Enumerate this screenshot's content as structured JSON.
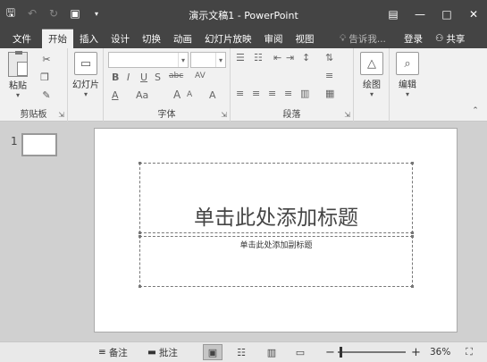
{
  "window": {
    "title": "演示文稿1 - PowerPoint"
  },
  "qat": {
    "save_icon": "save-icon",
    "undo_icon": "undo-icon",
    "redo_icon": "redo-icon",
    "present_icon": "present-from-start-icon",
    "customize_icon": "customize-qat-icon"
  },
  "tabs": [
    "文件",
    "开始",
    "插入",
    "设计",
    "切换",
    "动画",
    "幻灯片放映",
    "审阅",
    "视图"
  ],
  "active_tab": "开始",
  "tell_me": "告诉我...",
  "login": "登录",
  "share": "共享",
  "ribbon": {
    "clipboard": {
      "label": "剪贴板",
      "paste": "粘贴"
    },
    "slides": {
      "new_slide": "幻灯片"
    },
    "font": {
      "label": "字体",
      "bold": "B",
      "italic": "I",
      "underline": "U",
      "shadow": "S",
      "strike": "abc",
      "spacing": "AV",
      "color": "A",
      "case": "Aa",
      "grow": "A",
      "shrink": "A",
      "clear": "A"
    },
    "paragraph": {
      "label": "段落"
    },
    "drawing": {
      "label": "绘图"
    },
    "editing": {
      "label": "编辑"
    }
  },
  "slide_thumb": {
    "number": "1"
  },
  "slide": {
    "title_placeholder": "单击此处添加标题",
    "subtitle_placeholder": "单击此处添加副标题"
  },
  "status": {
    "notes": "备注",
    "comments": "批注",
    "zoom_minus": "−",
    "zoom_plus": "+",
    "zoom": "36%",
    "zoom_fraction": 0.36
  }
}
